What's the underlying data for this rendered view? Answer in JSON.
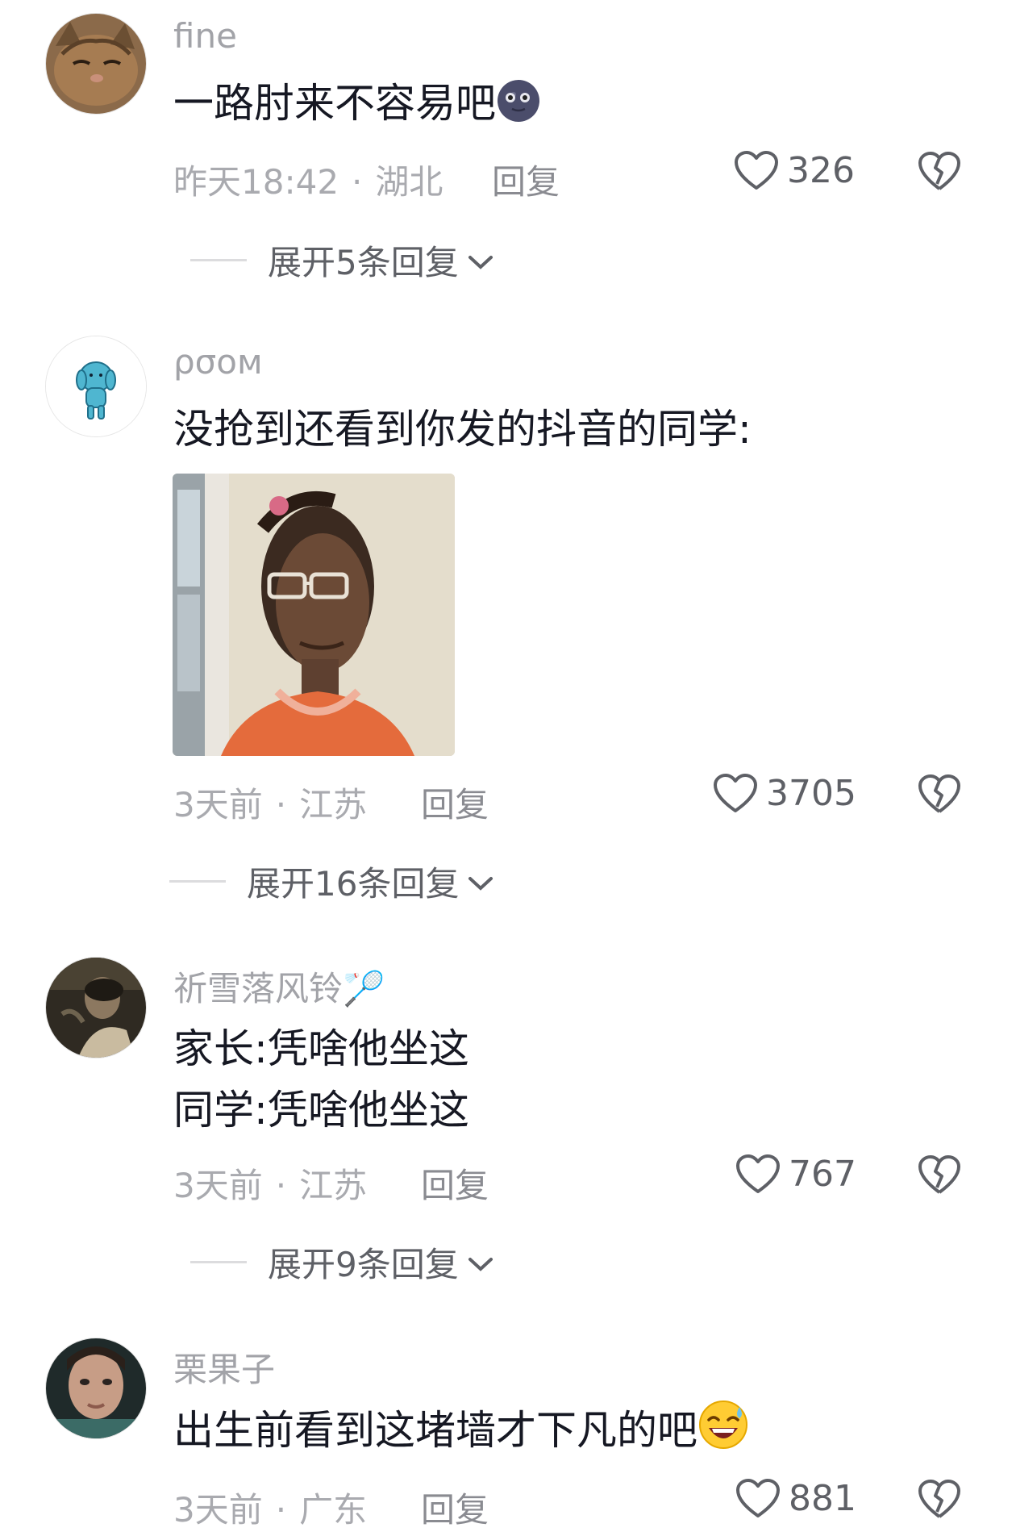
{
  "comments": [
    {
      "username": "fine",
      "lines": [
        "一路肘来不容易吧"
      ],
      "emoji": "new-moon-face",
      "time": "昨天18:42",
      "location": "湖北",
      "reply_label": "回复",
      "likes": "326",
      "expand_label": "展开5条回复"
    },
    {
      "username": "ρσοм",
      "lines": [
        "没抢到还看到你发的抖音的同学:"
      ],
      "time": "3天前",
      "location": "江苏",
      "reply_label": "回复",
      "likes": "3705",
      "expand_label": "展开16条回复"
    },
    {
      "username": "祈雪落风铃🏸",
      "lines": [
        "家长:凭啥他坐这",
        "同学:凭啥他坐这"
      ],
      "time": "3天前",
      "location": "江苏",
      "reply_label": "回复",
      "likes": "767",
      "expand_label": "展开9条回复"
    },
    {
      "username": "栗果子",
      "lines": [
        "出生前看到这堵墙才下凡的吧"
      ],
      "emoji": "grinning-sweat-face",
      "time": "3天前",
      "location": "广东",
      "reply_label": "回复",
      "likes": "881"
    }
  ],
  "separator": "·",
  "colors": {
    "text_primary": "#161823",
    "text_secondary": "#a2a3a8",
    "action_gray": "#5e6066"
  }
}
